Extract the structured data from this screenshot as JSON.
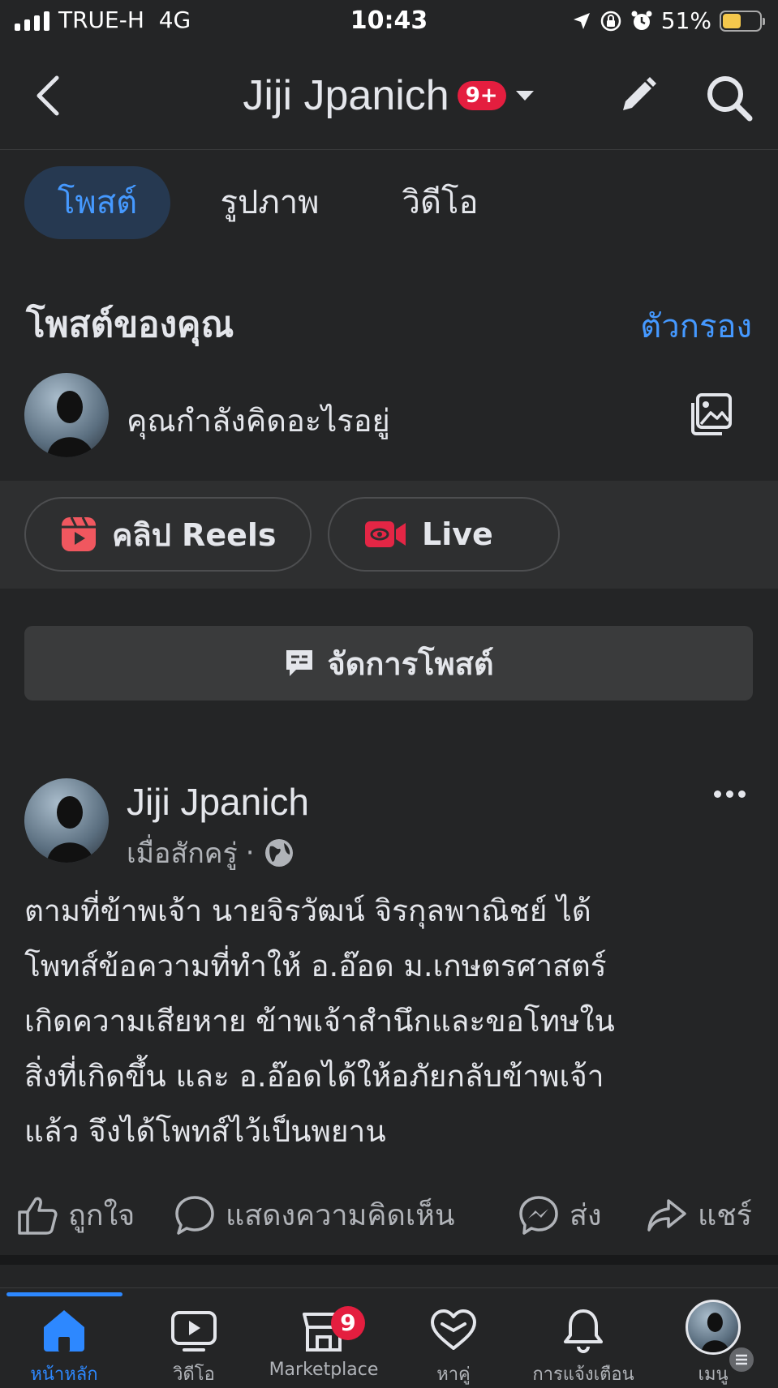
{
  "status_bar": {
    "carrier": "TRUE-H",
    "network": "4G",
    "time": "10:43",
    "battery_percent": "51%",
    "battery_level": 0.51,
    "battery_color": "#f5c84c"
  },
  "header": {
    "title": "Jiji Jpanich",
    "notification_badge": "9+"
  },
  "tabs": [
    {
      "label": "โพสต์",
      "active": true
    },
    {
      "label": "รูปภาพ",
      "active": false
    },
    {
      "label": "วิดีโอ",
      "active": false
    }
  ],
  "section": {
    "title": "โพสต์ของคุณ",
    "filter_label": "ตัวกรอง"
  },
  "composer": {
    "placeholder": "คุณกำลังคิดอะไรอยู่"
  },
  "quick_actions": {
    "reels_label": "คลิป Reels",
    "live_label": "Live"
  },
  "manage_posts_label": "จัดการโพสต์",
  "post": {
    "author": "Jiji Jpanich",
    "time": "เมื่อสักครู่",
    "audience_icon": "globe-icon",
    "text": "ตามที่ข้าพเจ้า นายจิรวัฒน์ จิรกุลพาณิชย์ ได้\nโพทส์ข้อความที่ทำให้ อ.อ๊อด ม.เกษตรศาสตร์\nเกิดความเสียหาย ข้าพเจ้าสำนึกและขอโทษใน\nสิ่งที่เกิดขึ้น และ อ.อ๊อดได้ให้อภัยกลับข้าพเจ้า\nแล้ว จึงได้โพทส์ไว้เป็นพยาน",
    "actions": {
      "like": "ถูกใจ",
      "comment": "แสดงความคิดเห็น",
      "send": "ส่ง",
      "share": "แชร์"
    }
  },
  "bottom_nav": [
    {
      "label": "หน้าหลัก",
      "icon": "home-icon",
      "active": true
    },
    {
      "label": "วิดีโอ",
      "icon": "video-icon",
      "active": false
    },
    {
      "label": "Marketplace",
      "icon": "marketplace-icon",
      "badge": "9",
      "active": false
    },
    {
      "label": "หาคู่",
      "icon": "dating-heart-icon",
      "active": false
    },
    {
      "label": "การแจ้งเตือน",
      "icon": "bell-icon",
      "active": false
    },
    {
      "label": "เมนู",
      "icon": "avatar-menu-icon",
      "active": false
    }
  ],
  "colors": {
    "accent": "#2d88ff",
    "link": "#4599ff",
    "background": "#242526",
    "badge": "#e41e3f",
    "reels": "#f0575f",
    "live": "#e42645"
  }
}
